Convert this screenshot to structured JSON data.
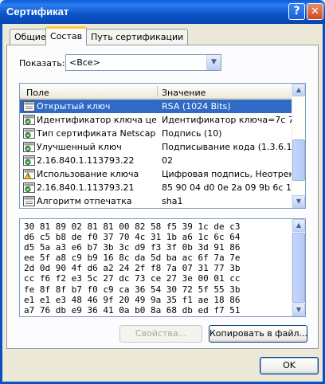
{
  "window": {
    "title": "Сертификат",
    "help_glyph": "?",
    "close_glyph": "✕"
  },
  "tabs": [
    {
      "label": "Общие",
      "active": false
    },
    {
      "label": "Состав",
      "active": true
    },
    {
      "label": "Путь сертификации",
      "active": false
    }
  ],
  "show": {
    "label": "Показать:",
    "selected": "<Все>"
  },
  "list": {
    "columns": {
      "field": "Поле",
      "value": "Значение"
    },
    "rows": [
      {
        "icon": "field-doc-icon",
        "field": "Открытый ключ",
        "value": "RSA (1024 Bits)",
        "selected": true
      },
      {
        "icon": "extension-icon",
        "field": "Идентификатор ключа це...",
        "value": "Идентификатор ключа=7c 7...",
        "selected": false
      },
      {
        "icon": "extension-icon",
        "field": "Тип сертификата Netscape",
        "value": "Подпись (10)",
        "selected": false
      },
      {
        "icon": "extension-icon",
        "field": "Улучшенный ключ",
        "value": "Подписывание кода (1.3.6.1....",
        "selected": false
      },
      {
        "icon": "extension-icon",
        "field": "2.16.840.1.113793.22",
        "value": "02",
        "selected": false
      },
      {
        "icon": "warning-extension-icon",
        "field": "Использование ключа",
        "value": "Цифровая подпись, Неотрек...",
        "selected": false
      },
      {
        "icon": "extension-icon",
        "field": "2.16.840.1.113793.21",
        "value": "85 90 04 d0 0e 2a 09 9b 6c 19...",
        "selected": false
      },
      {
        "icon": "field-doc-icon",
        "field": "Алгоритм отпечатка",
        "value": "sha1",
        "selected": false
      }
    ]
  },
  "hex": {
    "lines": [
      "30 81 89 02 81 81 00 82 58 f5 39 1c de c3",
      "d6 c5 b8 de f0 37 70 4c 31 1b a6 1c 6c 64",
      "d5 5a a3 e6 b7 3b 3c d9 f3 3f 0b 3d 91 86",
      "ee 5f a8 c9 b9 16 8c da 5d ba ac 6f 7a 7e",
      "2d 0d 90 4f d6 a2 24 2f f8 7a 07 31 77 3b",
      "cc f6 f2 e3 5c 27 dc 73 ce 27 3e 00 01 cc",
      "fe 8f 8f b7 f0 c9 ca 36 54 30 72 5f 55 3b",
      "e1 e1 e3 48 46 9f 20 49 9a 35 f1 ae 18 86",
      "a7 76 db e9 36 41 0a b0 8a 68 db ed f7 51"
    ]
  },
  "buttons": {
    "properties": "Свойства...",
    "copy_to_file": "Копировать в файл...",
    "ok": "OK"
  }
}
